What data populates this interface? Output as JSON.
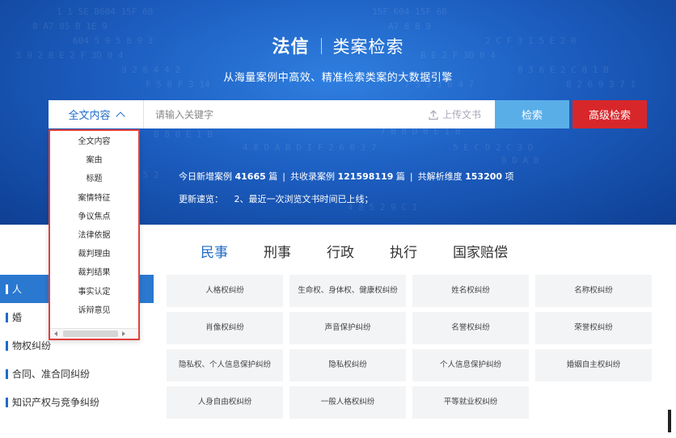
{
  "brand": {
    "name": "法信",
    "product": "类案检索"
  },
  "tagline": "从海量案例中高效、精准检索类案的大数据引擎",
  "search": {
    "scope_label": "全文内容",
    "placeholder": "请输入关键字",
    "upload_label": "上传文书",
    "search_button": "检索",
    "advanced_button": "高级检索"
  },
  "stats": {
    "new_label": "今日新增案例",
    "new_count": "41665",
    "unit": "篇",
    "total_label": "共收录案例",
    "total_count": "121598119",
    "dim_label": "共解析维度",
    "dim_count": "153200",
    "dim_unit": "项"
  },
  "updates": {
    "label": "更新速览：",
    "text": "2、最近一次浏览文书时间已上线；"
  },
  "dropdown": {
    "items": [
      "全文内容",
      "案由",
      "标题",
      "案情特征",
      "争议焦点",
      "法律依据",
      "裁判理由",
      "裁判结果",
      "事实认定",
      "诉辩意见"
    ]
  },
  "tabs": [
    "民事",
    "刑事",
    "行政",
    "执行",
    "国家赔偿"
  ],
  "left_list": [
    "人",
    "婚",
    "物权纠纷",
    "合同、准合同纠纷",
    "知识产权与竞争纠纷"
  ],
  "grid": [
    "人格权纠纷",
    "生命权、身体权、健康权纠纷",
    "姓名权纠纷",
    "名称权纠纷",
    "肖像权纠纷",
    "声音保护纠纷",
    "名誉权纠纷",
    "荣誉权纠纷",
    "隐私权、个人信息保护纠纷",
    "隐私权纠纷",
    "个人信息保护纠纷",
    "婚姻自主权纠纷",
    "人身自由权纠纷",
    "一般人格权纠纷",
    "平等就业权纠纷"
  ],
  "colors": {
    "primary": "#1e6ac8",
    "search_btn": "#5aaee8",
    "advanced_btn": "#d8272b",
    "dropdown_border": "#e0403e"
  }
}
